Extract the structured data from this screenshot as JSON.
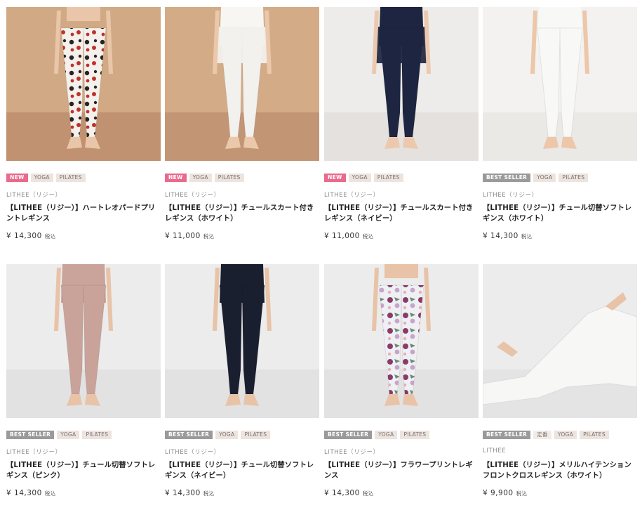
{
  "products": [
    {
      "tags": [
        {
          "text": "NEW",
          "kind": "new"
        },
        {
          "text": "YOGA",
          "kind": "cat"
        },
        {
          "text": "PILATES",
          "kind": "cat"
        }
      ],
      "brand": "LITHEE（リジー）",
      "name": "【LITHEE（リジー）】ハートレオパードプリントレギンス",
      "price": "¥ 14,300",
      "tax": "税込",
      "image": {
        "bg": "#d1a985",
        "floor": "#c09271",
        "garment": "leopard",
        "top": null,
        "skin": "#e9c6a9"
      }
    },
    {
      "tags": [
        {
          "text": "NEW",
          "kind": "new"
        },
        {
          "text": "YOGA",
          "kind": "cat"
        },
        {
          "text": "PILATES",
          "kind": "cat"
        }
      ],
      "brand": "LITHEE（リジー）",
      "name": "【LITHEE（リジー）】チュールスカート付きレギンス（ホワイト）",
      "price": "¥ 11,000",
      "tax": "税込",
      "image": {
        "bg": "#d3ac87",
        "floor": "#c29574",
        "garment": "#f3f1ee",
        "top": "#f7f6f3",
        "skin": "#ebc8ab"
      }
    },
    {
      "tags": [
        {
          "text": "NEW",
          "kind": "new"
        },
        {
          "text": "YOGA",
          "kind": "cat"
        },
        {
          "text": "PILATES",
          "kind": "cat"
        }
      ],
      "brand": "LITHEE（リジー）",
      "name": "【LITHEE（リジー）】チュールスカート付きレギンス（ネイビー）",
      "price": "¥ 11,000",
      "tax": "税込",
      "image": {
        "bg": "#eeecea",
        "floor": "#e4e1de",
        "garment": "#1e2540",
        "top": "#1e2540",
        "skin": "#ecc9ae"
      }
    },
    {
      "tags": [
        {
          "text": "BEST SELLER",
          "kind": "best"
        },
        {
          "text": "YOGA",
          "kind": "cat"
        },
        {
          "text": "PILATES",
          "kind": "cat"
        }
      ],
      "brand": "LITHEE（リジー）",
      "name": "【LITHEE（リジー）】チュール切替ソフトレギンス（ホワイト）",
      "price": "¥ 14,300",
      "tax": "税込",
      "image": {
        "bg": "#f3f2f0",
        "floor": "#ebe9e6",
        "garment": "#f8f8f6",
        "top": "#f8f8f6",
        "skin": "#ecc7aa"
      }
    },
    {
      "tags": [
        {
          "text": "BEST SELLER",
          "kind": "best"
        },
        {
          "text": "YOGA",
          "kind": "cat"
        },
        {
          "text": "PILATES",
          "kind": "cat"
        }
      ],
      "brand": "LITHEE（リジー）",
      "name": "【LITHEE（リジー）】チュール切替ソフトレギンス（ピンク）",
      "price": "¥ 14,300",
      "tax": "税込",
      "image": {
        "bg": "#ececec",
        "floor": "#e2e2e2",
        "garment": "#c9a39a",
        "top": "#caa49b",
        "skin": "#e8c3a7"
      }
    },
    {
      "tags": [
        {
          "text": "BEST SELLER",
          "kind": "best"
        },
        {
          "text": "YOGA",
          "kind": "cat"
        },
        {
          "text": "PILATES",
          "kind": "cat"
        }
      ],
      "brand": "LITHEE（リジー）",
      "name": "【LITHEE（リジー）】チュール切替ソフトレギンス（ネイビー）",
      "price": "¥ 14,300",
      "tax": "税込",
      "image": {
        "bg": "#ececec",
        "floor": "#e2e2e2",
        "garment": "#1a1f30",
        "top": "#1a1f30",
        "skin": "#e8c3a7"
      }
    },
    {
      "tags": [
        {
          "text": "BEST SELLER",
          "kind": "best"
        },
        {
          "text": "YOGA",
          "kind": "cat"
        },
        {
          "text": "PILATES",
          "kind": "cat"
        }
      ],
      "brand": "LITHEE（リジー）",
      "name": "【LITHEE（リジー）】フラワープリントレギンス",
      "price": "¥ 14,300",
      "tax": "税込",
      "image": {
        "bg": "#ececec",
        "floor": "#e2e2e2",
        "garment": "floral",
        "top": null,
        "skin": "#e8c3a7"
      }
    },
    {
      "tags": [
        {
          "text": "BEST SELLER",
          "kind": "best"
        },
        {
          "text": "定番",
          "kind": "plain"
        },
        {
          "text": "YOGA",
          "kind": "cat"
        },
        {
          "text": "PILATES",
          "kind": "cat"
        }
      ],
      "brand": "LITHEE",
      "name": "【LITHEE（リジー）】メリルハイテンションフロントクロスレギンス（ホワイト）",
      "price": "¥ 9,900",
      "tax": "税込",
      "image": {
        "bg": "#ececec",
        "floor": "#e4e4e4",
        "garment": "#f7f7f5",
        "top": "#f7f7f5",
        "skin": "#e8c3a7"
      }
    }
  ]
}
